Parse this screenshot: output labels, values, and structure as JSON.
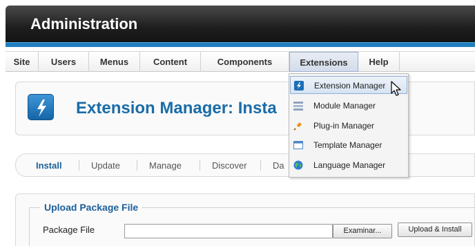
{
  "header": {
    "title": "Administration"
  },
  "menu": {
    "items": [
      {
        "label": "Site"
      },
      {
        "label": "Users"
      },
      {
        "label": "Menus"
      },
      {
        "label": "Content"
      },
      {
        "label": "Components"
      },
      {
        "label": "Extensions",
        "active": true
      },
      {
        "label": "Help"
      }
    ]
  },
  "dropdown": {
    "items": [
      {
        "label": "Extension Manager",
        "icon": "lightning-icon",
        "hover": true
      },
      {
        "label": "Module Manager",
        "icon": "module-icon"
      },
      {
        "label": "Plug-in Manager",
        "icon": "plugin-icon"
      },
      {
        "label": "Template Manager",
        "icon": "template-icon"
      },
      {
        "label": "Language Manager",
        "icon": "globe-icon"
      }
    ]
  },
  "page": {
    "title": "Extension Manager: Insta"
  },
  "tabs": [
    {
      "label": "Install",
      "active": true
    },
    {
      "label": "Update"
    },
    {
      "label": "Manage"
    },
    {
      "label": "Discover"
    },
    {
      "label": "Da"
    }
  ],
  "upload": {
    "legend": "Upload Package File",
    "field_label": "Package File",
    "browse_button": "Examinar...",
    "install_button": "Upload & Install"
  },
  "colors": {
    "brand_blue": "#1f7fc0",
    "title_blue": "#1a6ca8",
    "header_dark": "#1e1e1e"
  }
}
